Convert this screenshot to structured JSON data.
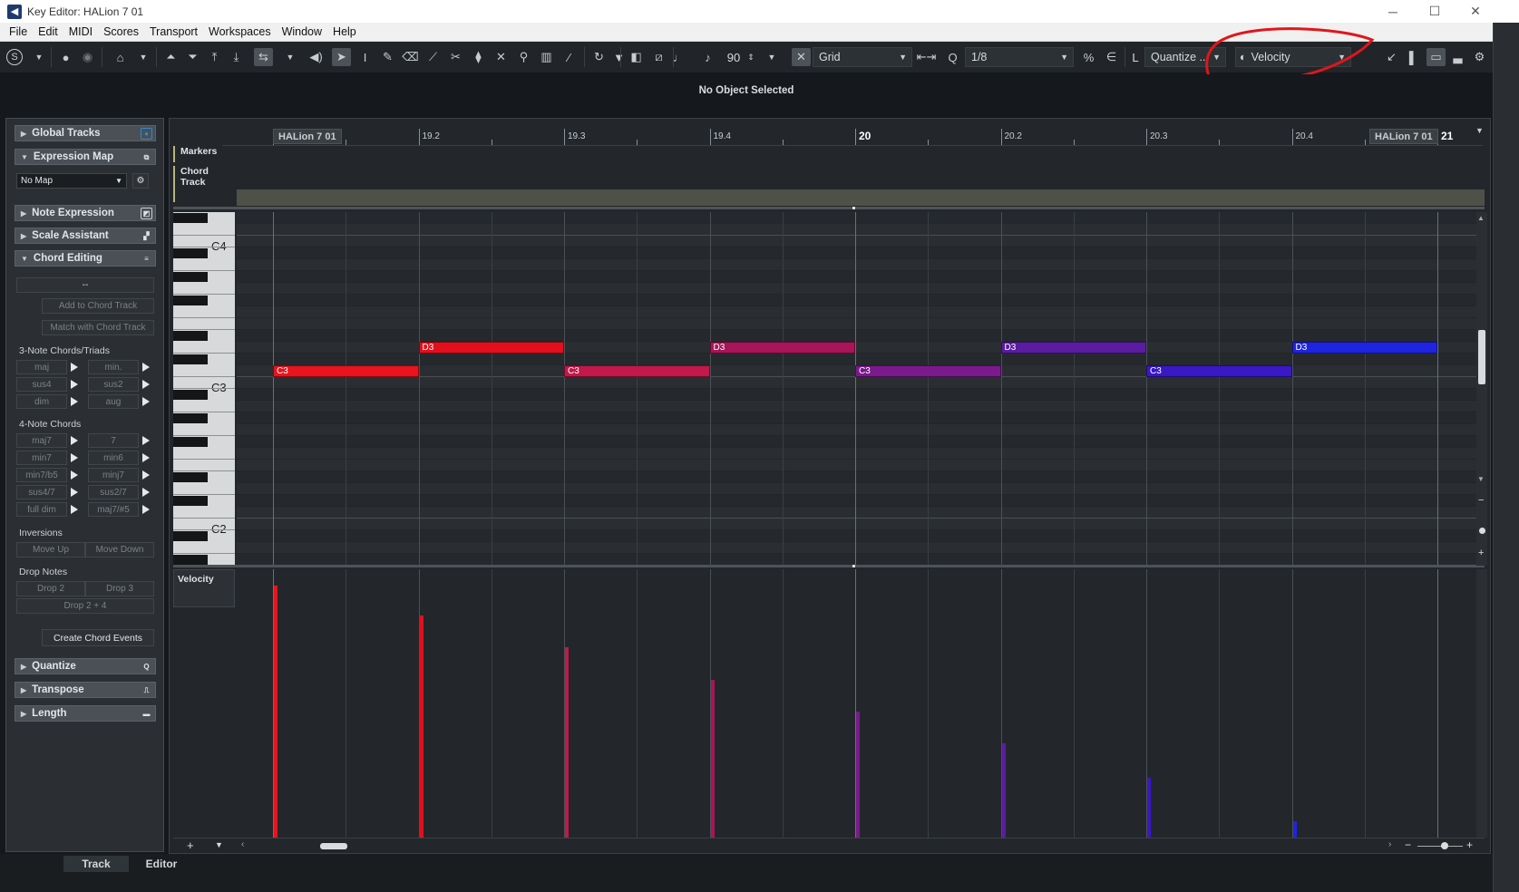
{
  "window": {
    "title": "Key Editor: HALion 7 01",
    "controls": [
      "─",
      "☐",
      "✕"
    ]
  },
  "menu": [
    "File",
    "Edit",
    "MIDI",
    "Scores",
    "Transport",
    "Workspaces",
    "Window",
    "Help"
  ],
  "toolbar": {
    "length_value": "90",
    "snap_mode": "Grid",
    "quantize_value": "1/8",
    "quantize_preset": "Quantize ...",
    "controller_lane": "Velocity"
  },
  "info_line": "No Object Selected",
  "inspector": {
    "sections": {
      "global_tracks": "Global Tracks",
      "expression_map": "Expression Map",
      "note_expression": "Note Expression",
      "scale_assistant": "Scale Assistant",
      "chord_editing": "Chord Editing",
      "quantize": "Quantize",
      "transpose": "Transpose",
      "length": "Length"
    },
    "expression_map_value": "No Map",
    "chord_display": "--",
    "add_to_chord_track": "Add to Chord Track",
    "match_with_chord_track": "Match with Chord Track",
    "triads_label": "3-Note Chords/Triads",
    "triads": [
      "maj",
      "min.",
      "sus4",
      "sus2",
      "dim",
      "aug"
    ],
    "four_note_label": "4-Note Chords",
    "four_note": [
      "maj7",
      "7",
      "min7",
      "min6",
      "min7/b5",
      "minj7",
      "sus4/7",
      "sus2/7",
      "full dim",
      "maj7/#5"
    ],
    "inversions_label": "Inversions",
    "inversions": [
      "Move Up",
      "Move Down"
    ],
    "drop_notes_label": "Drop Notes",
    "drop_notes": [
      "Drop 2",
      "Drop 3",
      "Drop 2 + 4"
    ],
    "create_chord_events": "Create Chord Events"
  },
  "ruler": {
    "event_name": "HALion 7 01",
    "marks": [
      "19.2",
      "19.3",
      "19.4",
      "20",
      "20.2",
      "20.3",
      "20.4",
      "21"
    ]
  },
  "tracks": {
    "markers": "Markers",
    "chord_track": "Chord Track"
  },
  "keys": {
    "c4": "C4",
    "c3": "C3",
    "c2": "C2"
  },
  "notes": [
    {
      "label": "C3",
      "color": "#e8141e"
    },
    {
      "label": "D3",
      "color": "#e2101e"
    },
    {
      "label": "C3",
      "color": "#c0194a"
    },
    {
      "label": "D3",
      "color": "#a81559"
    },
    {
      "label": "C3",
      "color": "#7a1a8c"
    },
    {
      "label": "D3",
      "color": "#5a1ca0"
    },
    {
      "label": "C3",
      "color": "#3a18c4"
    },
    {
      "label": "D3",
      "color": "#1f24e0"
    }
  ],
  "velocity_lane": {
    "label": "Velocity",
    "velocities": [
      127,
      112,
      96,
      80,
      64,
      48,
      31,
      9
    ]
  },
  "bottom_tabs": [
    "Track",
    "Editor"
  ]
}
